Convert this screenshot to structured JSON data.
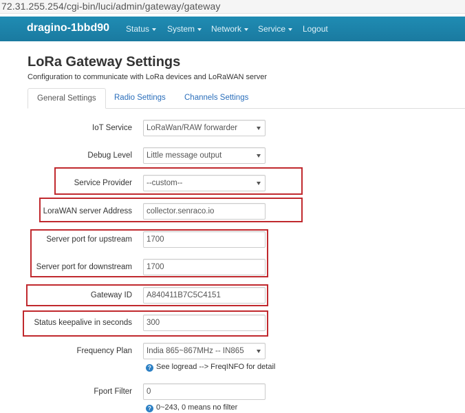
{
  "browser": {
    "url": "72.31.255.254/cgi-bin/luci/admin/gateway/gateway"
  },
  "navbar": {
    "brand": "dragino-1bbd90",
    "items": [
      {
        "label": "Status"
      },
      {
        "label": "System"
      },
      {
        "label": "Network"
      },
      {
        "label": "Service"
      },
      {
        "label": "Logout"
      }
    ]
  },
  "page": {
    "title": "LoRa Gateway Settings",
    "description": "Configuration to communicate with LoRa devices and LoRaWAN server"
  },
  "tabs": [
    {
      "label": "General Settings",
      "active": true
    },
    {
      "label": "Radio Settings",
      "active": false
    },
    {
      "label": "Channels Settings",
      "active": false
    }
  ],
  "form": {
    "iot_service": {
      "label": "IoT Service",
      "value": "LoRaWan/RAW forwarder"
    },
    "debug_level": {
      "label": "Debug Level",
      "value": "Little message output"
    },
    "service_provider": {
      "label": "Service Provider",
      "value": "--custom--"
    },
    "server_address": {
      "label": "LoraWAN server Address",
      "value": "collector.senraco.io"
    },
    "port_up": {
      "label": "Server port for upstream",
      "value": "1700"
    },
    "port_down": {
      "label": "Server port for downstream",
      "value": "1700"
    },
    "gateway_id": {
      "label": "Gateway ID",
      "value": "A840411B7C5C4151"
    },
    "keepalive": {
      "label": "Status keepalive in seconds",
      "value": "300"
    },
    "frequency_plan": {
      "label": "Frequency Plan",
      "value": "India 865~867MHz -- IN865",
      "hint": "See logread --> FreqINFO for detail"
    },
    "fport_filter": {
      "label": "Fport Filter",
      "value": "0",
      "hint": "0~243, 0 means no filter"
    }
  },
  "colors": {
    "navbar": "#1a7aa0",
    "highlight_box": "#c0282d",
    "link": "#2a6ebb"
  },
  "icons": {
    "help": "help-circle-icon",
    "dropdown": "caret-down-icon"
  }
}
